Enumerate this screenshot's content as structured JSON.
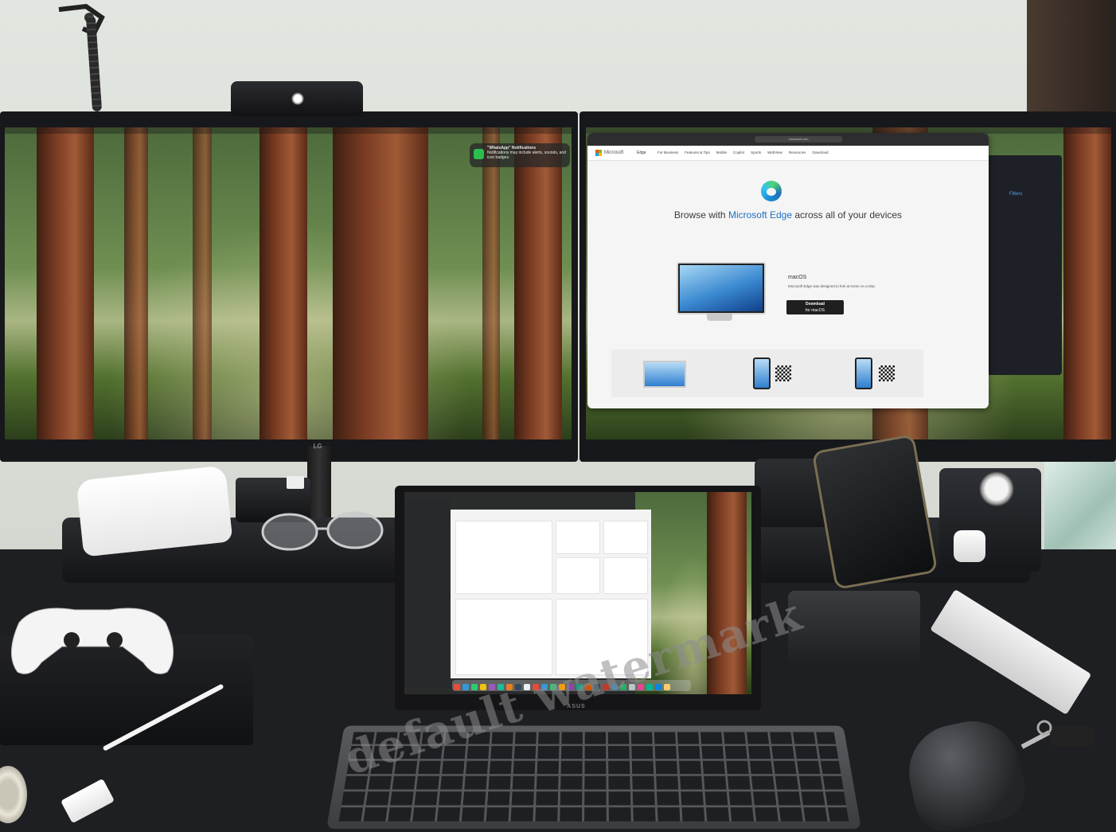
{
  "scene": {
    "description_tags": [
      "desk-setup",
      "dual-monitors",
      "laptop",
      "keyboard",
      "mouse"
    ]
  },
  "left_monitor": {
    "brand": "LG",
    "notification": {
      "title": "\"WhatsApp\" Notifications",
      "body": "Notifications may include alerts, sounds, and icon badges."
    }
  },
  "right_monitor": {
    "browser": {
      "address": "microsoft.com",
      "nav": {
        "brand": "Microsoft",
        "product": "Edge",
        "links": [
          "For Business",
          "Features & Tips",
          "Mobile",
          "Copilot",
          "Sports",
          "WebView",
          "Resources",
          "Download"
        ]
      },
      "headline_prefix": "Browse with ",
      "headline_highlight": "Microsoft Edge",
      "headline_suffix": " across all of your devices",
      "platform_label": "macOS",
      "platform_desc": "Microsoft Edge was designed to feel at home on a Mac",
      "download_label": "Download",
      "download_sub": "for macOS"
    },
    "side_panel": {
      "filters_label": "Filters"
    }
  },
  "laptop": {
    "brand": "ASUS"
  },
  "watermark": {
    "text": "default watermark"
  },
  "colors": {
    "edge_blue": "#1e6fbf",
    "desk": "#1e1f22",
    "wall": "#dcdfd9"
  }
}
